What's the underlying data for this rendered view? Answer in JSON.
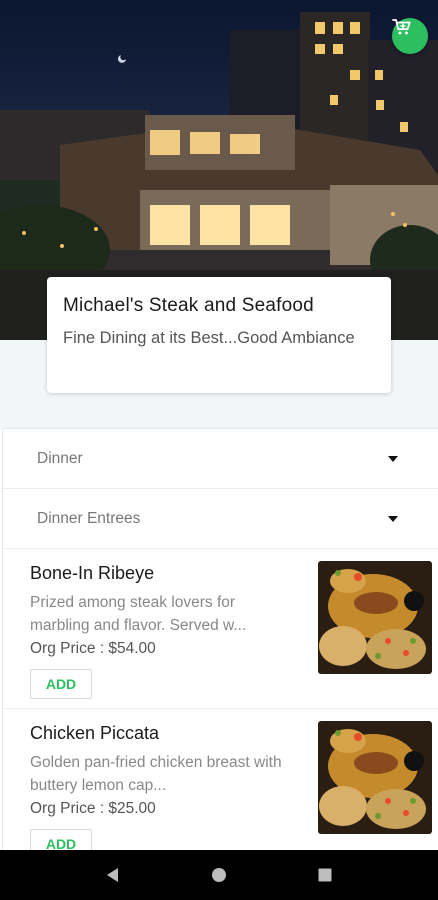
{
  "restaurant": {
    "name": "Michael's Steak and Seafood",
    "tagline": "Fine Dining at its Best...Good Ambiance"
  },
  "header": {
    "cart_icon": "cart-icon"
  },
  "filters": {
    "menu_select": {
      "selected": "Dinner"
    },
    "category_select": {
      "selected": "Dinner Entrees"
    }
  },
  "items": [
    {
      "title": "Bone-In Ribeye",
      "description": "Prized among steak lovers for marbling and flavor.  Served w...",
      "price": "Org Price : $54.00",
      "add_label": "ADD"
    },
    {
      "title": "Chicken Piccata",
      "description": "Golden pan-fried chicken breast with buttery lemon cap...",
      "price": "Org Price : $25.00",
      "add_label": "ADD"
    }
  ],
  "colors": {
    "accent": "#2dbe60",
    "navbar": "#000000"
  },
  "system_nav": {
    "back_icon": "back-icon",
    "home_icon": "home-icon",
    "recents_icon": "recents-icon"
  }
}
